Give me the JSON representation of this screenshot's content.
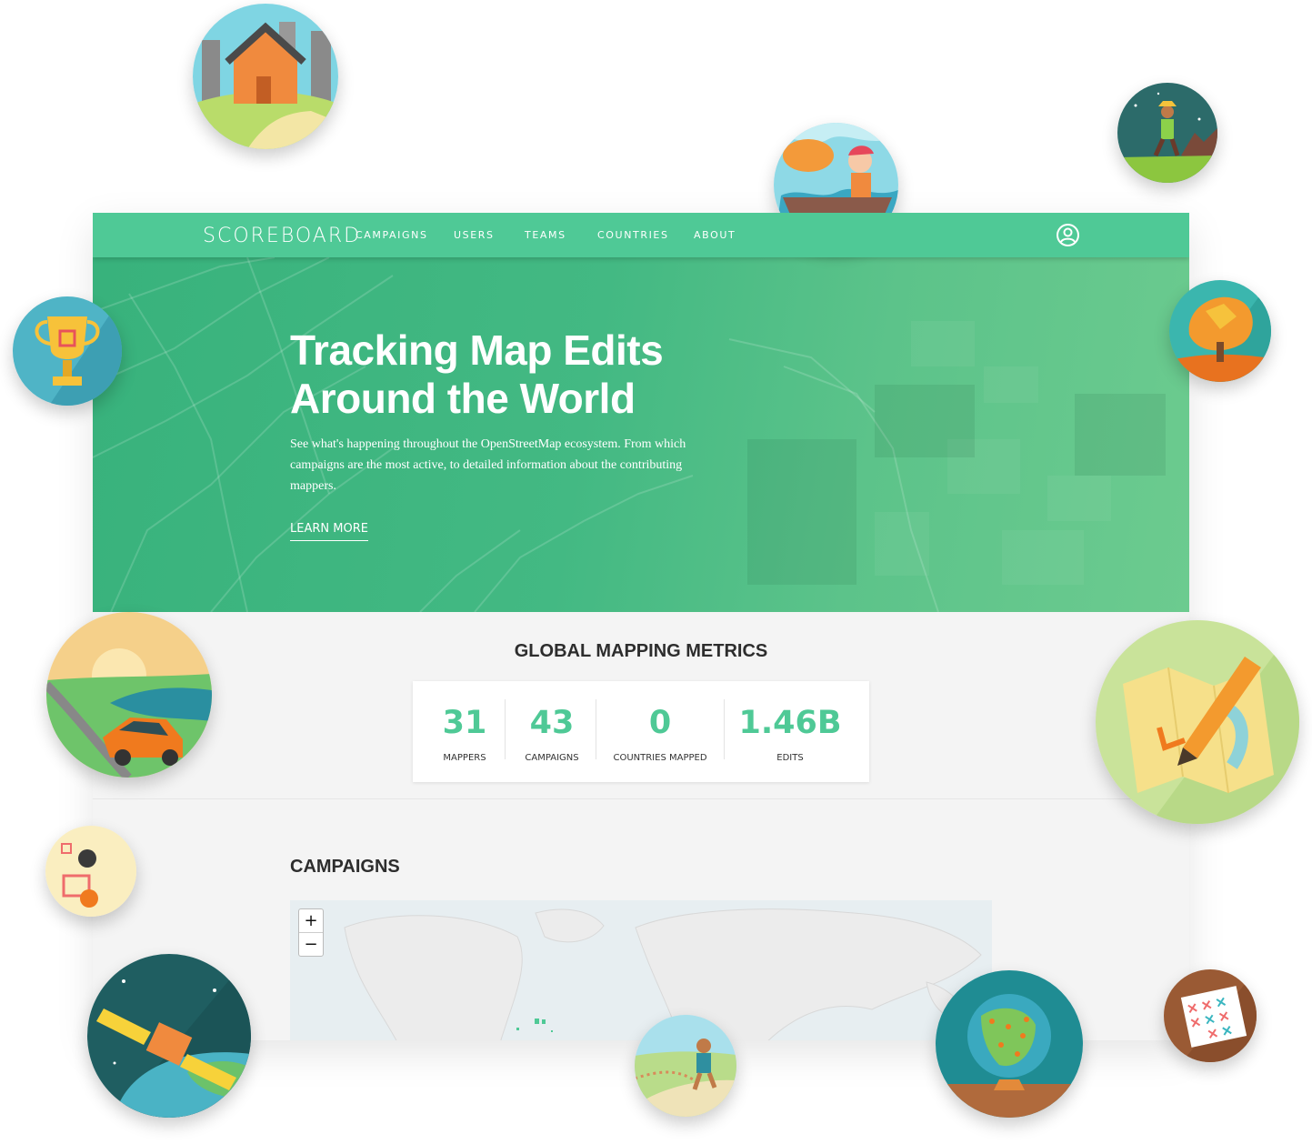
{
  "nav": {
    "brand": "SCOREBOARD",
    "links": [
      "CAMPAIGNS",
      "USERS",
      "TEAMS",
      "COUNTRIES",
      "ABOUT"
    ],
    "account_icon": "user-circle-icon"
  },
  "hero": {
    "title": "Tracking Map Edits Around the World",
    "description": "See what's happening throughout the OpenStreetMap ecosystem. From which campaigns are the most active, to detailed information about the contributing mappers.",
    "cta": "LEARN MORE"
  },
  "metrics": {
    "title": "GLOBAL MAPPING METRICS",
    "items": [
      {
        "value": "31",
        "label": "MAPPERS"
      },
      {
        "value": "43",
        "label": "CAMPAIGNS"
      },
      {
        "value": "0",
        "label": "COUNTRIES MAPPED"
      },
      {
        "value": "1.46B",
        "label": "EDITS"
      }
    ]
  },
  "campaigns": {
    "title": "CAMPAIGNS",
    "zoom_in": "+",
    "zoom_out": "−"
  },
  "colors": {
    "accent": "#4fc996",
    "hero_green": "#3fb780",
    "text_dark": "#2d2d2d"
  },
  "decorative_badges": [
    "house-illustration",
    "fish-boat-illustration",
    "hiker-illustration",
    "trophy-illustration",
    "autumn-tree-illustration",
    "car-coast-illustration",
    "map-pencil-illustration",
    "bingo-illustration",
    "satellite-illustration",
    "runner-illustration",
    "globe-illustration",
    "calendar-illustration"
  ]
}
